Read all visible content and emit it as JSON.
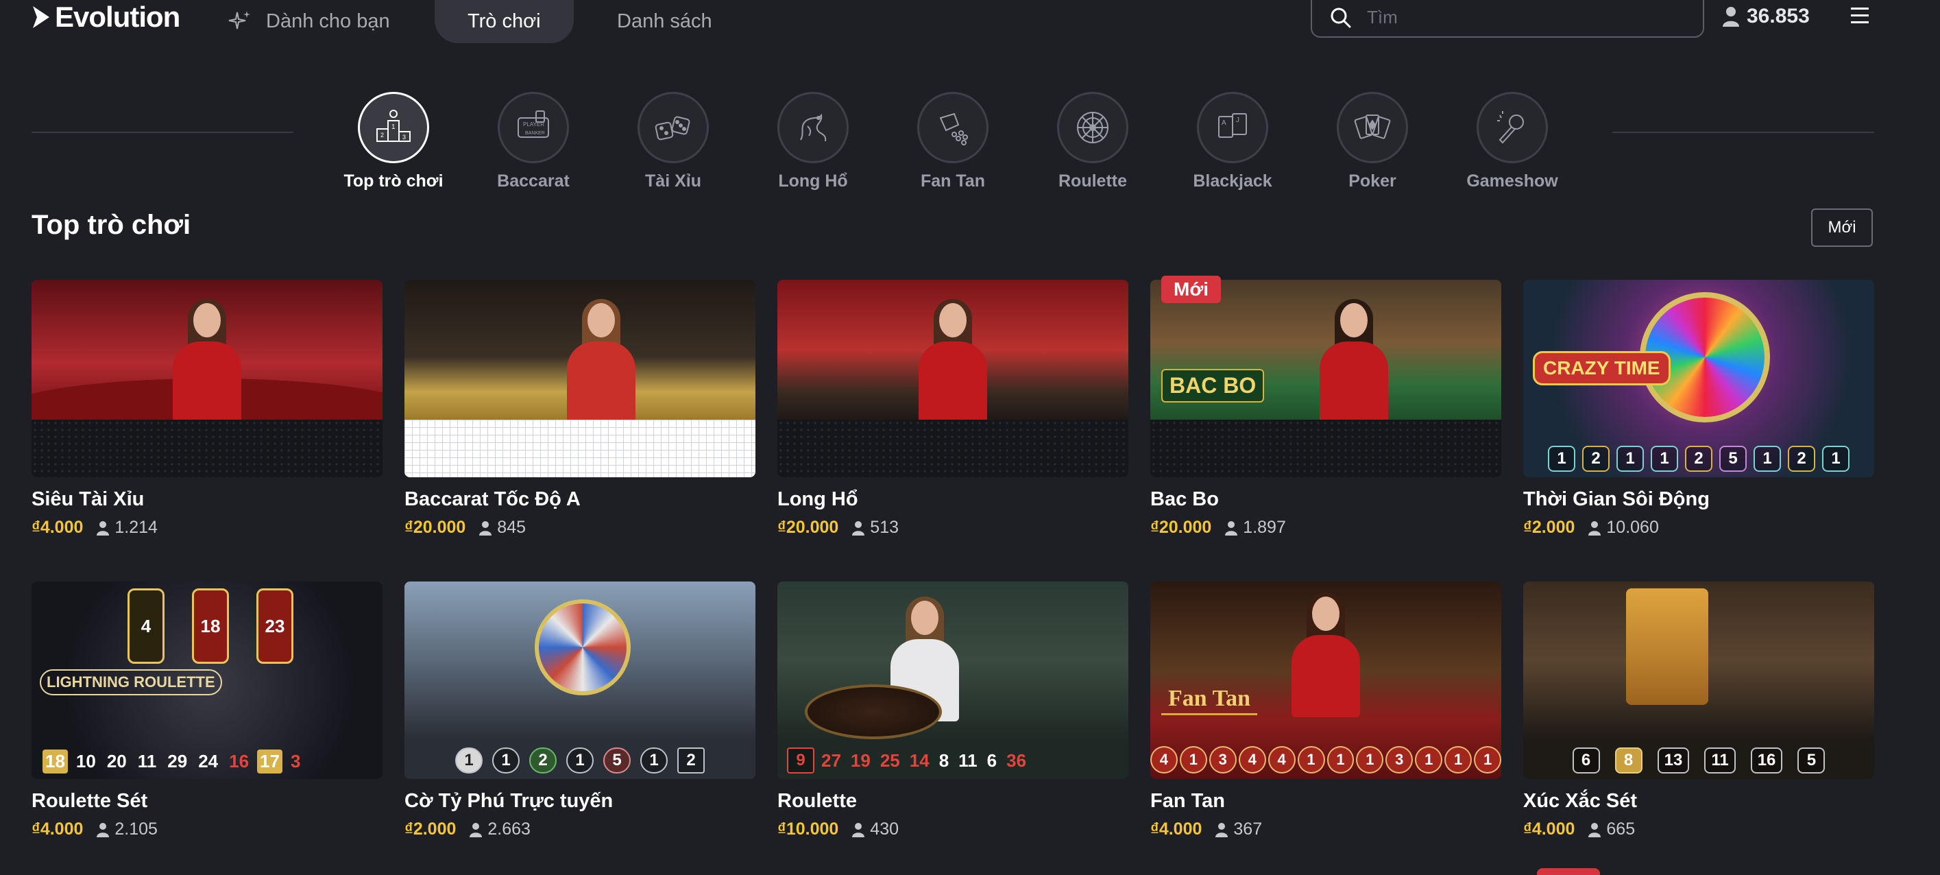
{
  "header": {
    "logo": "Evolution",
    "nav": [
      {
        "label": "Dành cho bạn"
      },
      {
        "label": "Trò chơi"
      },
      {
        "label": "Danh sách"
      }
    ],
    "search_placeholder": "Tìm",
    "player_count": "36.853"
  },
  "categories": [
    {
      "label": "Top trò chơi",
      "icon": "podium-icon"
    },
    {
      "label": "Baccarat",
      "icon": "baccarat-icon"
    },
    {
      "label": "Tài Xỉu",
      "icon": "dice-icon"
    },
    {
      "label": "Long Hổ",
      "icon": "dragon-icon"
    },
    {
      "label": "Fan Tan",
      "icon": "fan-tan-icon"
    },
    {
      "label": "Roulette",
      "icon": "roulette-icon"
    },
    {
      "label": "Blackjack",
      "icon": "cards-icon"
    },
    {
      "label": "Poker",
      "icon": "poker-icon"
    },
    {
      "label": "Gameshow",
      "icon": "microphone-icon"
    }
  ],
  "section": {
    "title": "Top trò chơi",
    "sort_label": "Mới"
  },
  "games": [
    {
      "name": "Siêu Tài Xỉu",
      "bet": "₫4.000",
      "players": "1.214"
    },
    {
      "name": "Baccarat Tốc Độ A",
      "bet": "₫20.000",
      "players": "845"
    },
    {
      "name": "Long Hổ",
      "bet": "₫20.000",
      "players": "513"
    },
    {
      "name": "Bac Bo",
      "bet": "₫20.000",
      "players": "1.897",
      "badge": "Mới",
      "logo": "BAC BO"
    },
    {
      "name": "Thời Gian Sôi Động",
      "bet": "₫2.000",
      "players": "10.060",
      "logo": "CRAZY TIME",
      "results": [
        "1",
        "2",
        "1",
        "1",
        "2",
        "5",
        "1",
        "2",
        "1"
      ]
    },
    {
      "name": "Roulette Sét",
      "bet": "₫4.000",
      "players": "2.105",
      "logo": "LIGHTNING ROULETTE",
      "multipliers": [
        "4",
        "18",
        "23"
      ],
      "results": [
        "18",
        "10",
        "20",
        "11",
        "29",
        "24",
        "16",
        "17",
        "3"
      ]
    },
    {
      "name": "Cờ Tỷ Phú Trực tuyến",
      "bet": "₫2.000",
      "players": "2.663",
      "results": [
        "1",
        "1",
        "2",
        "1",
        "5",
        "1",
        "2"
      ]
    },
    {
      "name": "Roulette",
      "bet": "₫10.000",
      "players": "430",
      "results": [
        "9",
        "27",
        "19",
        "25",
        "14",
        "8",
        "11",
        "6",
        "36"
      ]
    },
    {
      "name": "Fan Tan",
      "bet": "₫4.000",
      "players": "367",
      "logo": "Fan Tan",
      "results": [
        "4",
        "1",
        "3",
        "4",
        "4",
        "1",
        "1",
        "1",
        "3",
        "1",
        "1",
        "1"
      ]
    },
    {
      "name": "Xúc Xắc Sét",
      "bet": "₫4.000",
      "players": "665",
      "results": [
        "6",
        "8",
        "13",
        "11",
        "16",
        "5"
      ]
    }
  ],
  "colors": {
    "background": "#1e1f24",
    "bet": "#f5c533",
    "badge": "#d6353d",
    "red_number": "#e3453d"
  }
}
